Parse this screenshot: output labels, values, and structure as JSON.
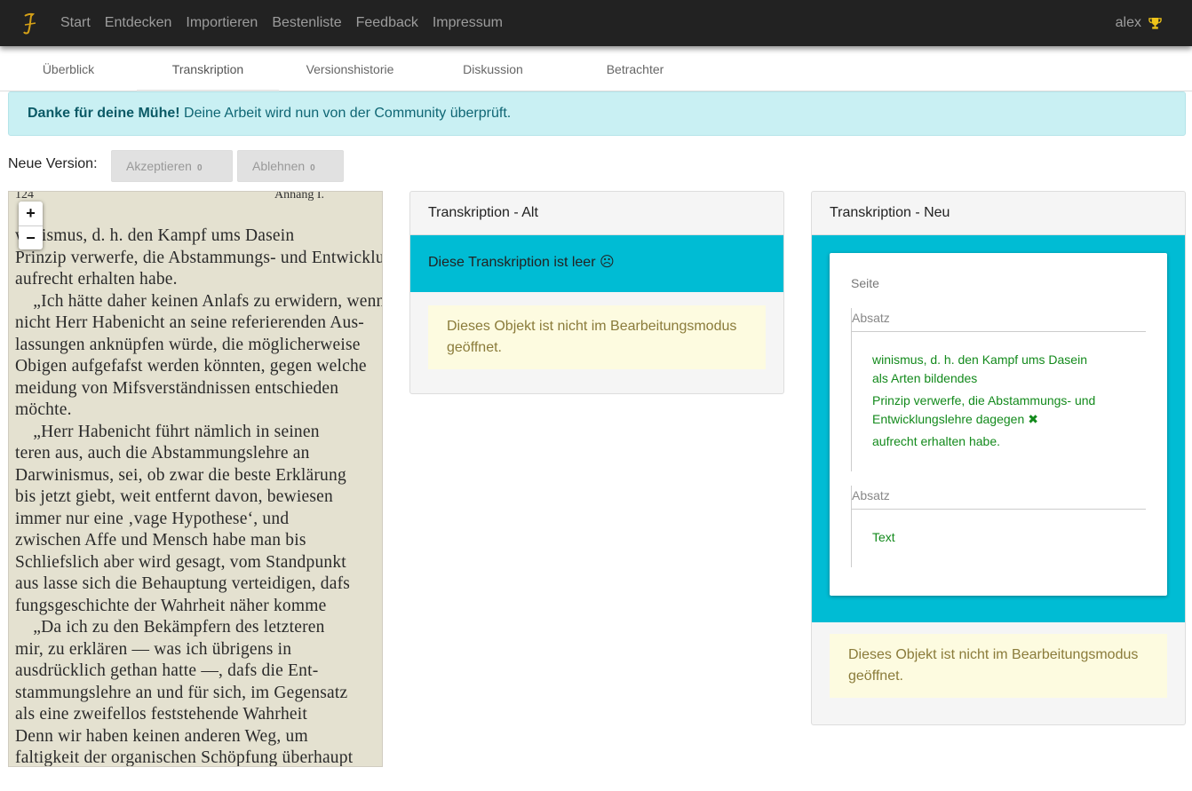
{
  "navbar": {
    "brand_icon": "quill-logo",
    "links": [
      "Start",
      "Entdecken",
      "Importieren",
      "Bestenliste",
      "Feedback",
      "Impressum"
    ],
    "user": "alex",
    "user_icon": "trophy-icon"
  },
  "tabs": [
    "Überblick",
    "Transkription",
    "Versionshistorie",
    "Diskussion",
    "Betrachter"
  ],
  "active_tab": "Transkription",
  "alert": {
    "strong": "Danke für deine Mühe!",
    "text": " Deine Arbeit wird nun von der Community überprüft."
  },
  "version": {
    "label": "Neue Version:",
    "accept_label": "Akzeptieren",
    "accept_count": "0",
    "reject_label": "Ablehnen",
    "reject_count": "0"
  },
  "viewer": {
    "zoom_in": "+",
    "zoom_out": "−",
    "page_number": "124",
    "page_header": "Anhang I.",
    "lines": [
      "winismus, d. h. den Kampf ums Dasein",
      "Prinzip verwerfe, die Abstammungs- und Entwicklungslehre",
      "aufrecht erhalten habe.",
      "    „Ich hätte daher keinen Anlafs zu erwidern, wenn",
      "nicht Herr Habenicht an seine referierenden Aus-",
      "lassungen anknüpfen würde, die möglicherweise",
      "Obigen aufgefafst werden könnten, gegen welche",
      "meidung von Mifsverständnissen entschieden",
      "möchte.",
      "    „Herr Habenicht führt nämlich in seinen",
      "teren aus, auch die Abstammungslehre an",
      "Darwinismus, sei, ob zwar die beste Erklärung",
      "bis jetzt giebt, weit entfernt davon, bewiesen",
      "immer nur eine ‚vage Hypothese‘, und",
      "zwischen Affe und Mensch habe man bis",
      "Schliefslich aber wird gesagt, vom Standpunkt",
      "aus lasse sich die Behauptung verteidigen, dafs",
      "fungsgeschichte der Wahrheit näher komme",
      "    „Da ich zu den Bekämpfern des letzteren",
      "mir, zu erklären — was ich übrigens in",
      "ausdrücklich gethan hatte —, dafs die Ent-",
      "stammungslehre an und für sich, im Gegensatz",
      "als eine zweifellos feststehende Wahrheit",
      "Denn wir haben keinen anderen Weg, um",
      "faltigkeit der organischen Schöpfung überhaupt"
    ]
  },
  "old_panel": {
    "title": "Transkription - Alt",
    "empty_text": "Diese Transkription ist leer ☹",
    "warning": "Dieses Objekt ist nicht im Bearbeitungsmodus geöffnet."
  },
  "new_panel": {
    "title": "Transkription - Neu",
    "seite_label": "Seite",
    "absatz1": {
      "label": "Absatz",
      "line1a": "winismus, d. h. den Kampf ums Dasein",
      "line1b": "als Arten bildendes",
      "line2a": "Prinzip verwerfe, die Abstammungs- und",
      "line2b": "Entwicklungslehre dagegen",
      "line2_icon": "close-icon",
      "line3": "aufrecht erhalten habe."
    },
    "absatz2": {
      "label": "Absatz",
      "line1": "Text"
    },
    "warning": "Dieses Objekt ist nicht im Bearbeitungsmodus geöffnet."
  },
  "colors": {
    "navbar": "#222222",
    "alert_bg": "#c9f0f3",
    "cyan": "#00bcd4",
    "green_text": "#138a1c",
    "warning_bg": "#fdfbe0"
  }
}
